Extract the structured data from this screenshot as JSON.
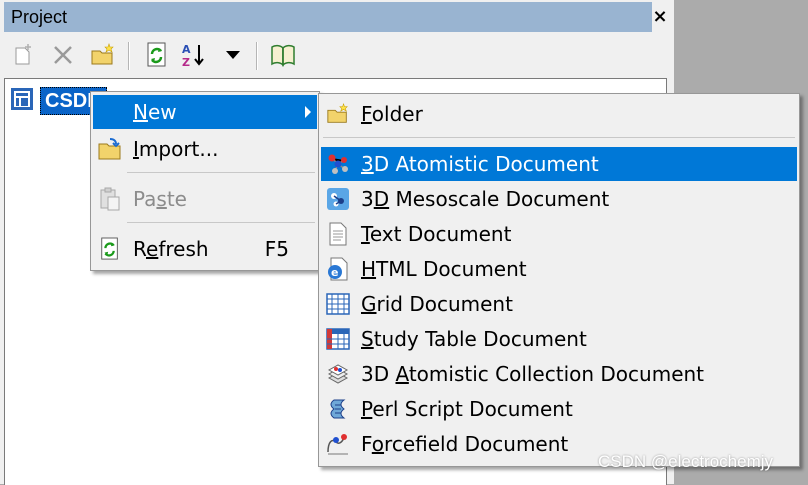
{
  "panel": {
    "title": "Project",
    "close_glyph": "×"
  },
  "toolbar": {
    "buttons": [
      {
        "icon": "new-item-icon"
      },
      {
        "icon": "delete-icon"
      },
      {
        "icon": "new-folder-icon"
      },
      {
        "icon": "refresh-icon"
      },
      {
        "icon": "sort-az-icon"
      },
      {
        "icon": "dropdown-arrow-icon"
      },
      {
        "icon": "book-icon"
      }
    ]
  },
  "tree": {
    "root_label": "CSDN"
  },
  "context_menu": {
    "items": [
      {
        "label": "New",
        "underline": "N",
        "rest": "ew",
        "highlighted": true,
        "submenu": true
      },
      {
        "label": "Import...",
        "underline": "I",
        "rest": "mport..."
      },
      {
        "label": "Paste",
        "pre": "Pa",
        "underline": "s",
        "rest": "te",
        "disabled": true
      },
      {
        "label": "Refresh",
        "pre": "R",
        "underline": "e",
        "rest": "fresh",
        "shortcut": "F5"
      }
    ]
  },
  "submenu": {
    "items": [
      {
        "label": "Folder",
        "underline": "F",
        "rest": "older",
        "icon": "folder-icon"
      },
      {
        "label": "3D Atomistic Document",
        "underline": "3",
        "rest": "D Atomistic Document",
        "icon": "atomistic-icon",
        "highlighted": true
      },
      {
        "label": "3D Mesoscale Document",
        "pre": "3",
        "underline": "D",
        "rest": " Mesoscale Document",
        "icon": "mesoscale-icon"
      },
      {
        "label": "Text Document",
        "underline": "T",
        "rest": "ext Document",
        "icon": "text-doc-icon"
      },
      {
        "label": "HTML Document",
        "underline": "H",
        "rest": "TML Document",
        "icon": "html-doc-icon"
      },
      {
        "label": "Grid Document",
        "underline": "G",
        "rest": "rid Document",
        "icon": "grid-doc-icon"
      },
      {
        "label": "Study Table Document",
        "underline": "S",
        "rest": "tudy Table Document",
        "icon": "study-table-icon"
      },
      {
        "label": "3D Atomistic Collection Document",
        "pre": "3D ",
        "underline": "A",
        "rest": "tomistic Collection Document",
        "icon": "collection-icon"
      },
      {
        "label": "Perl Script Document",
        "underline": "P",
        "rest": "erl Script Document",
        "icon": "perl-script-icon"
      },
      {
        "label": "Forcefield Document",
        "pre": "F",
        "underline": "o",
        "rest": "rcefield Document",
        "icon": "forcefield-icon"
      }
    ]
  },
  "watermark": "CSDN @electrochemjy"
}
